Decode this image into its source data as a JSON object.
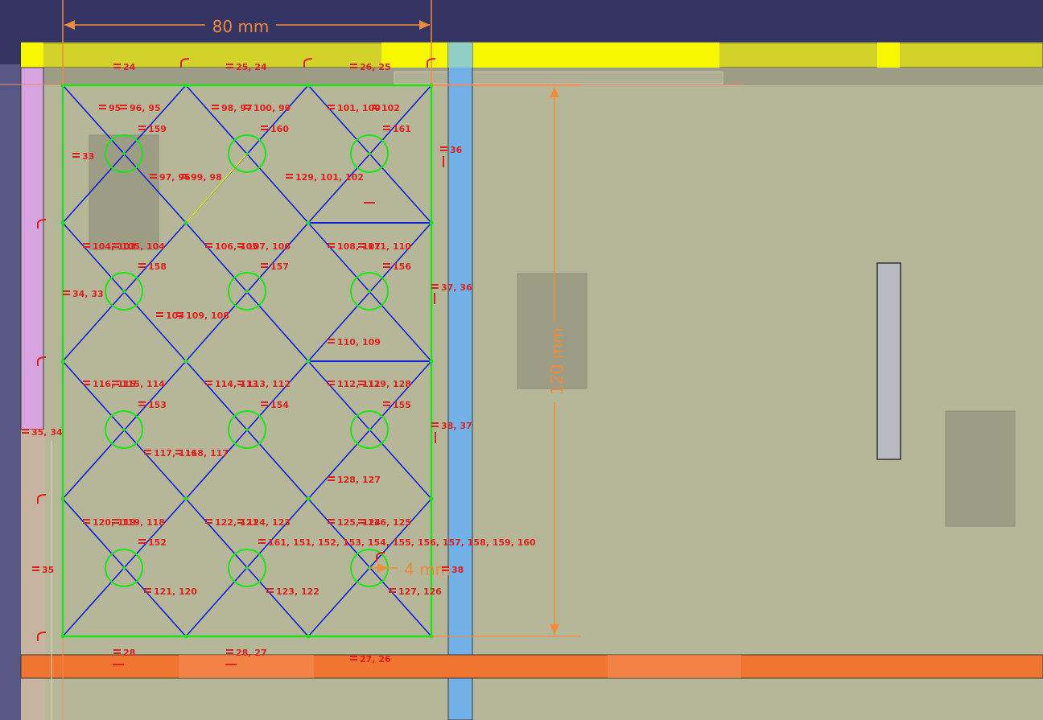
{
  "colors": {
    "background_top": "#343563",
    "model_face": "#b6b798",
    "yellow_bar": "#d2d22a",
    "yellow_bright": "#f7f700",
    "orange_bar": "#ef7530",
    "blue_bar": "#72b1e7",
    "pink_bar": "#d8a4e0",
    "sketch_green": "#19e519",
    "sketch_blue": "#1222d9",
    "constraint_red": "#e02020",
    "dimension_orange": "#f28c3a",
    "construction_yellow": "#e8e81c"
  },
  "dimensions": {
    "width_label": "80 mm",
    "height_label": "120 mm",
    "radius_label": "4 mm"
  },
  "constraint_labels": [
    "24",
    "25, 24",
    "26, 25",
    "95",
    "96, 95",
    "98, 97",
    "100, 99",
    "101, 100",
    "102",
    "159",
    "160",
    "161",
    "33",
    "36",
    "97, 96",
    "99, 98",
    "129, 101, 102",
    "104, 103",
    "105, 104",
    "106, 105",
    "107, 106",
    "108, 107",
    "111, 110",
    "158",
    "157",
    "156",
    "37, 36",
    "34, 33",
    "103",
    "109, 108",
    "110, 109",
    "116, 115",
    "115, 114",
    "114, 113",
    "113, 112",
    "112, 111",
    "129, 128",
    "153",
    "154",
    "155",
    "38, 37",
    "117, 116",
    "118, 117",
    "128, 127",
    "120, 119",
    "119, 118",
    "122, 121",
    "124, 123",
    "125, 124",
    "126, 125",
    "152",
    "161, 151, 152, 153, 154, 155, 156, 157, 158, 159, 160",
    "35",
    "38",
    "121, 120",
    "123, 122",
    "127, 126",
    "35, 34",
    "28",
    "28, 27",
    "27, 26"
  ],
  "icons": [
    "tangent-constraint-icon",
    "equal-constraint-icon",
    "vertical-constraint-icon",
    "horizontal-constraint-icon"
  ]
}
